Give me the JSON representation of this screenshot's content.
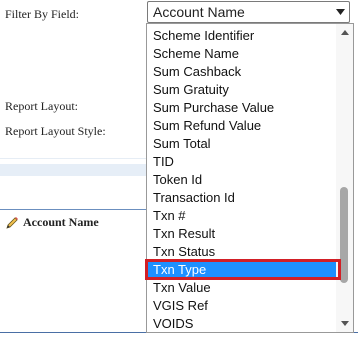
{
  "form": {
    "filter_by_field_label": "Filter By Field:",
    "report_layout_label": "Report Layout:",
    "report_layout_style_label": "Report Layout Style:"
  },
  "select": {
    "value": "Account Name",
    "icon": "chevron-down-icon"
  },
  "dropdown": {
    "options": [
      "Scheme Identifier",
      "Scheme Name",
      "Sum Cashback",
      "Sum Gratuity",
      "Sum Purchase Value",
      "Sum Refund Value",
      "Sum Total",
      "TID",
      "Token Id",
      "Transaction Id",
      "Txn #",
      "Txn Result",
      "Txn Status",
      "Txn Type",
      "Txn Value",
      "VGIS Ref",
      "VOIDS"
    ],
    "selected": "Txn Type",
    "scrollbar": {
      "position": 0.83
    }
  },
  "table": {
    "column_header": "Account Name",
    "column_icon": "pencil-icon"
  },
  "colors": {
    "selection": "#1e90ff",
    "highlight_border": "#d21f26"
  }
}
